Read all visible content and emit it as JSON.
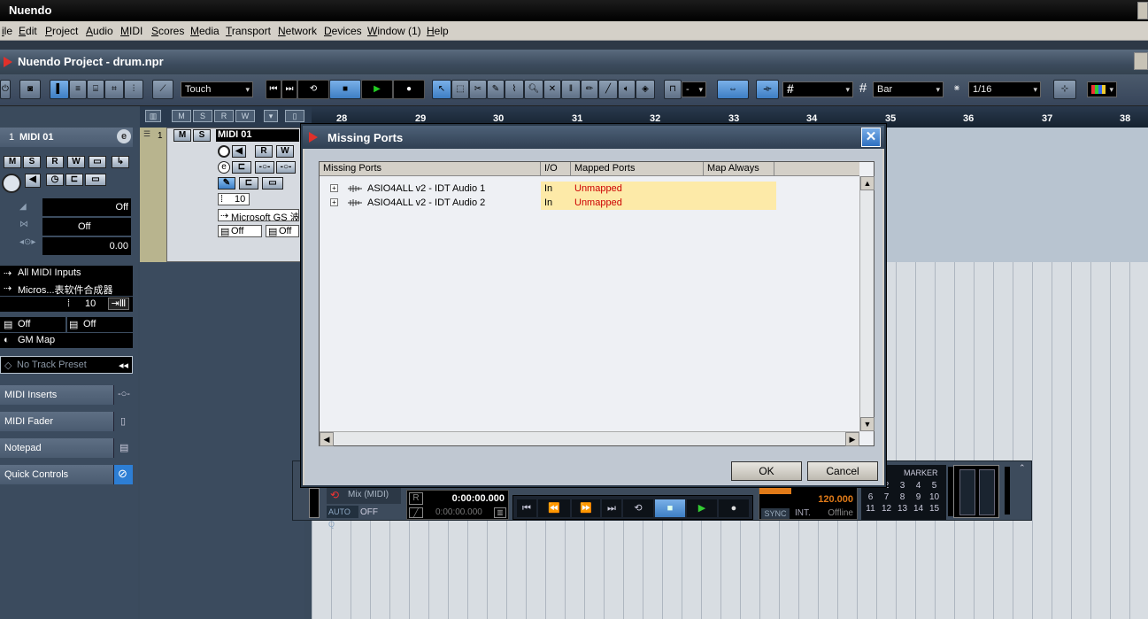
{
  "app": {
    "title": "Nuendo"
  },
  "menu": [
    "ile",
    "Edit",
    "Project",
    "Audio",
    "MIDI",
    "Scores",
    "Media",
    "Transport",
    "Network",
    "Devices",
    "Window (1)",
    "Help"
  ],
  "project": {
    "title": "Nuendo Project - drum.npr"
  },
  "toolbar": {
    "automation_mode": "Touch",
    "grid_mode": "Bar",
    "quantize": "1/16",
    "nudge_value": "-"
  },
  "ruler": {
    "bars": [
      "28",
      "29",
      "30",
      "31",
      "32",
      "33",
      "34",
      "35",
      "36",
      "37",
      "38"
    ]
  },
  "inspector": {
    "track_number": "1",
    "track_name": "MIDI 01",
    "mute": "M",
    "solo": "S",
    "read": "R",
    "write": "W",
    "volume": "Off",
    "pan": "Off",
    "delay": "0.00",
    "input": "All MIDI Inputs",
    "output": "Micros...表软件合成器",
    "channel": "10",
    "bank": "Off",
    "program": "Off",
    "drum_map": "GM Map",
    "track_preset": "No Track Preset",
    "sections": [
      "MIDI Inserts",
      "MIDI Fader",
      "Notepad",
      "Quick Controls"
    ]
  },
  "track": {
    "number": "1",
    "mute": "M",
    "solo": "S",
    "name": "MIDI 01",
    "read": "R",
    "write": "W",
    "channel": "10",
    "output": "Microsoft GS 波",
    "bank": "Off",
    "program": "Off"
  },
  "dialog": {
    "title": "Missing Ports",
    "columns": [
      "Missing Ports",
      "I/O",
      "Mapped Ports",
      "Map Always"
    ],
    "rows": [
      {
        "name": "ASIO4ALL v2 - IDT Audio 1",
        "io": "In",
        "mapped": "Unmapped"
      },
      {
        "name": "ASIO4ALL v2 - IDT Audio 2",
        "io": "In",
        "mapped": "Unmapped"
      }
    ],
    "ok_label": "OK",
    "cancel_label": "Cancel"
  },
  "transport": {
    "mix_label": "Mix (MIDI)",
    "auto_q": "AUTO Q",
    "auto_q_value": "OFF",
    "time_primary": "0:00:00.000",
    "time_secondary": "0:00:00.000",
    "tempo": "120.000",
    "sync": "SYNC",
    "int": "INT.",
    "offline": "Offline",
    "marker_label": "MARKER",
    "marker_keys": [
      "1",
      "2",
      "3",
      "4",
      "5",
      "6",
      "7",
      "8",
      "9",
      "10",
      "11",
      "12",
      "13",
      "14",
      "15"
    ]
  }
}
